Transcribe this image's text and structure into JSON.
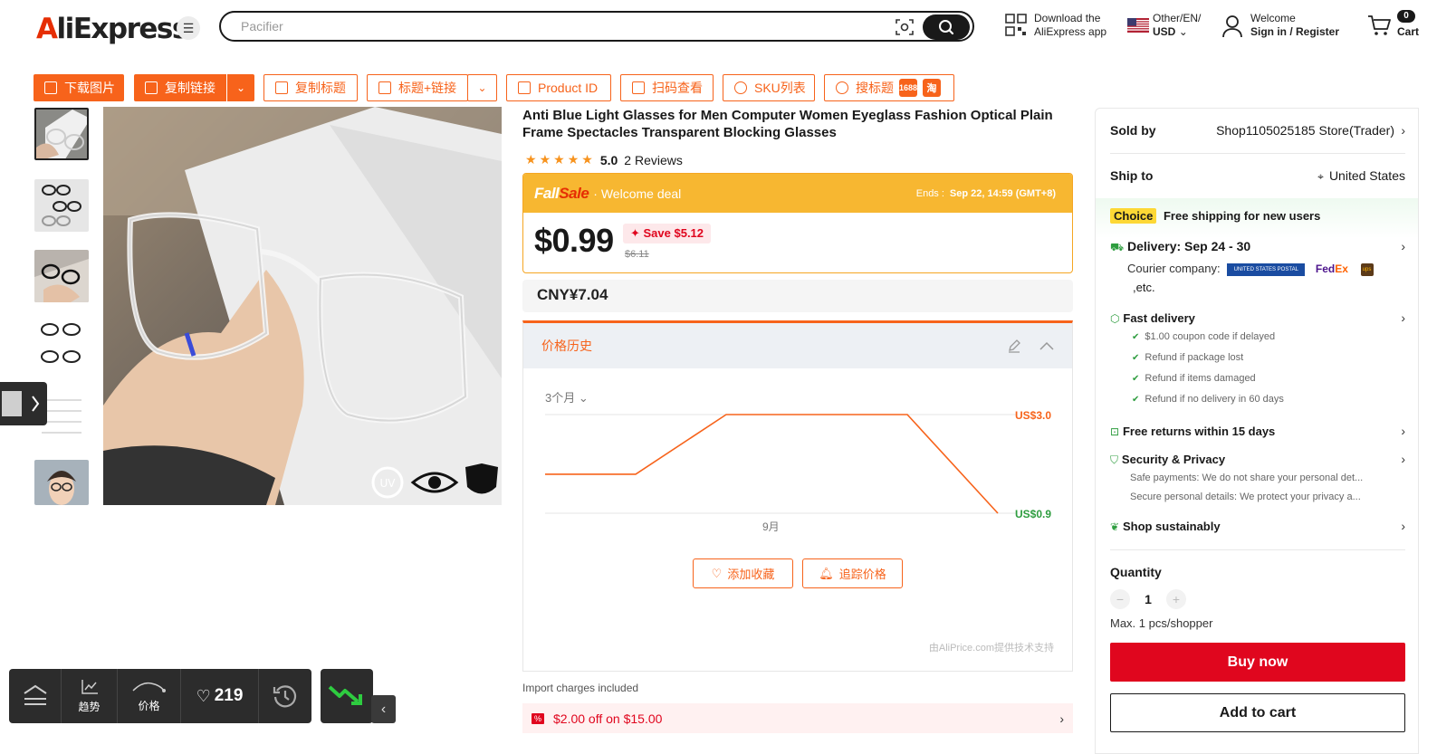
{
  "header": {
    "logo_a": "A",
    "logo_rest": "liExpress",
    "search_placeholder": "Pacifier",
    "download_line1": "Download the",
    "download_line2": "AliExpress app",
    "region_line1": "Other/EN/",
    "region_line2": "USD",
    "welcome_line1": "Welcome",
    "welcome_line2": "Sign in / Register",
    "cart_count": "0",
    "cart_label": "Cart"
  },
  "toolbar": {
    "download_image": "下载图片",
    "copy_link": "复制链接",
    "copy_title": "复制标题",
    "title_link": "标题+链接",
    "product_id": "Product ID",
    "scan_view": "扫码查看",
    "sku_list": "SKU列表",
    "search_title": "搜标题",
    "tag_1688": "1688",
    "tag_tao": "淘"
  },
  "product": {
    "title": "Anti Blue Light Glasses for Men Computer Women Eyeglass Fashion Optical Plain Frame Spectacles Transparent Blocking Glasses",
    "rating": "5.0",
    "reviews": "2 Reviews",
    "star_count": 5
  },
  "deal": {
    "brand_fall": "Fall",
    "brand_sale": "Sale",
    "welcome": "· Welcome deal",
    "ends_label": "Ends :",
    "ends_value": "Sep 22, 14:59 (GMT+8)",
    "price": "$0.99",
    "save": "Save $5.12",
    "original_price": "$6.11"
  },
  "cny_price": "CNY¥7.04",
  "price_history": {
    "title": "价格历史",
    "range": "3个月",
    "high_label": "US$3.0",
    "low_label": "US$0.9",
    "xtick": "9月",
    "add_fav": "添加收藏",
    "track_price": "追踪价格",
    "powered": "由AliPrice.com提供技术支持"
  },
  "chart_data": {
    "type": "line",
    "x": [
      0,
      1,
      2,
      3,
      4,
      5
    ],
    "values": [
      1.8,
      1.8,
      3.04,
      3.04,
      3.04,
      0.99
    ],
    "ylim": [
      0.99,
      3.04
    ],
    "xlabel": "",
    "ylabel": "",
    "tick_labels": [
      "9月"
    ],
    "grid": true,
    "colors": {
      "line": "#f7631b",
      "high": "#f7631b",
      "low": "#2e9d3f"
    }
  },
  "import_note": "Import charges included",
  "coupon": "$2.00 off on $15.00",
  "right": {
    "sold_by_label": "Sold by",
    "sold_by_value": "Shop1105025185 Store(Trader)",
    "ship_to_label": "Ship to",
    "ship_to_value": "United States",
    "choice_badge": "Choice",
    "choice_text": "Free shipping for new users",
    "delivery": "Delivery: Sep 24 - 30",
    "courier_label": "Courier company:",
    "courier_etc": ",etc.",
    "usps": "UNITED STATES POSTAL SERVICE",
    "fedex_fed": "Fed",
    "fedex_ex": "Ex",
    "ups": "ups",
    "fast_delivery": "Fast delivery",
    "fast_items": [
      "$1.00 coupon code if delayed",
      "Refund if package lost",
      "Refund if items damaged",
      "Refund if no delivery in 60 days"
    ],
    "free_returns": "Free returns within 15 days",
    "security": "Security & Privacy",
    "security_1": "Safe payments: We do not share your personal det...",
    "security_2": "Secure personal details: We protect your privacy a...",
    "sustain": "Shop sustainably",
    "quantity_label": "Quantity",
    "quantity_value": "1",
    "max_note": "Max. 1 pcs/shopper",
    "buy_now": "Buy now",
    "add_to_cart": "Add to cart"
  },
  "floating": {
    "trend": "趋势",
    "price": "价格",
    "likes": "219"
  },
  "colors": {
    "accent": "#f7631b",
    "brand_red": "#e0061e",
    "deal_yellow": "#f7b731"
  }
}
